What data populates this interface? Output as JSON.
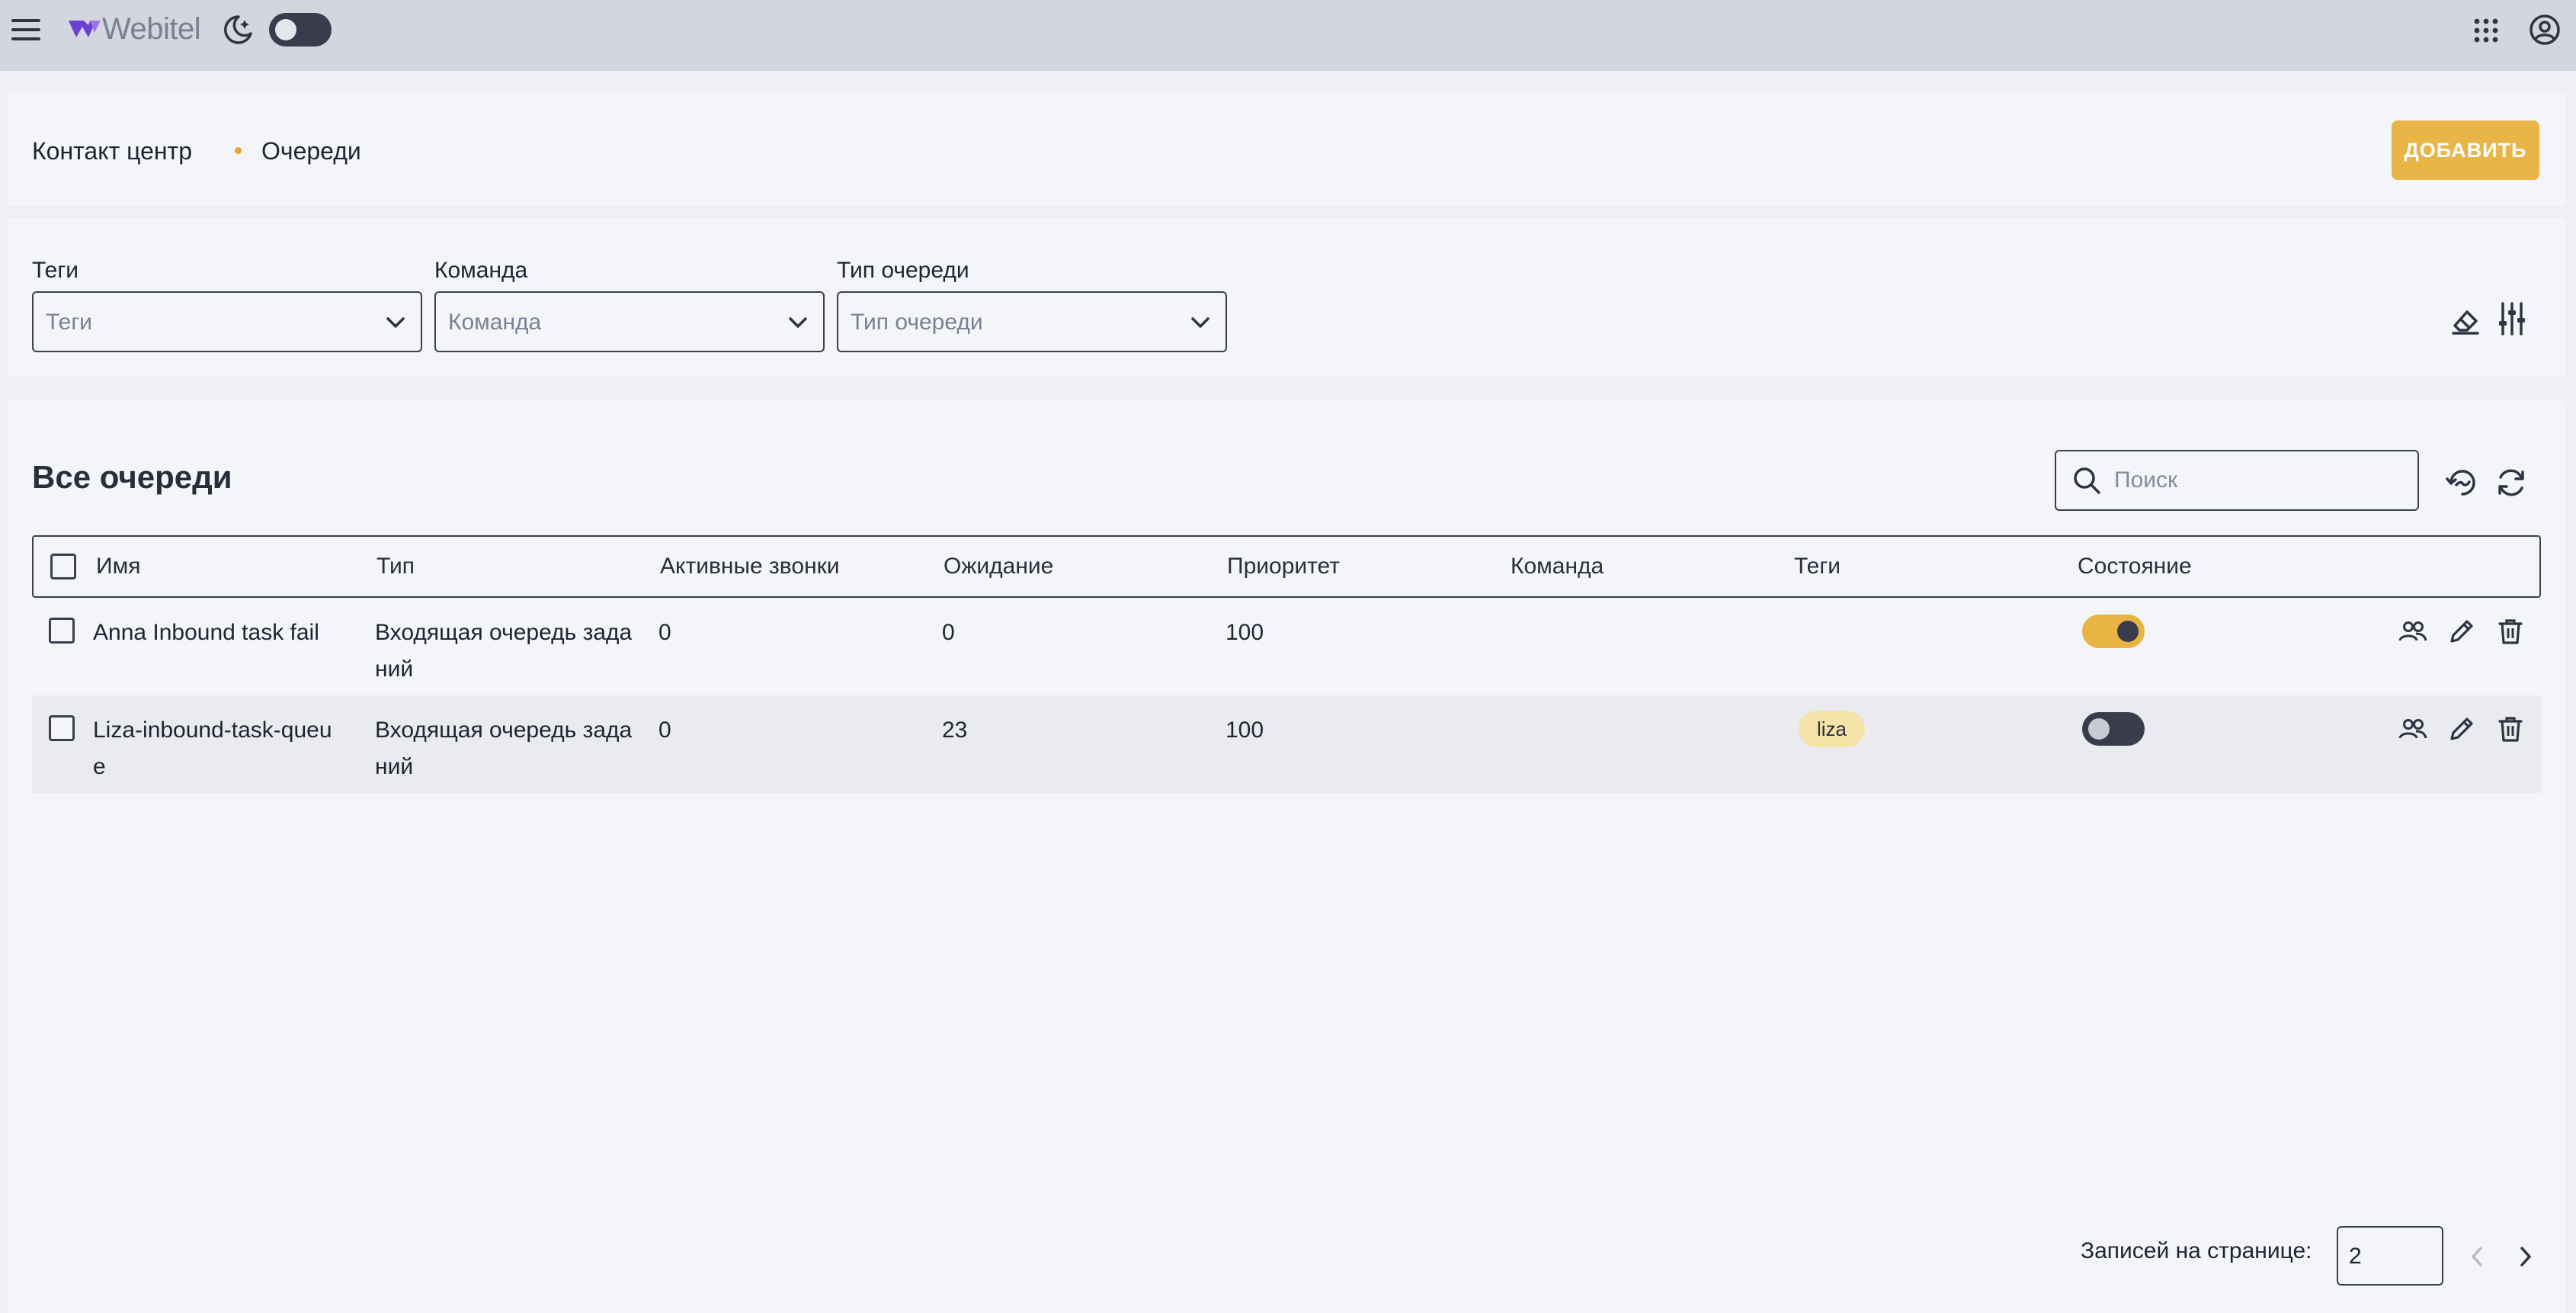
{
  "header": {
    "logo_text": "Webitel",
    "menu_icon": "hamburger-icon",
    "theme_icon": "moon-icon",
    "apps_icon": "apps-grid-icon",
    "account_icon": "user-circle-icon",
    "theme_dark": false
  },
  "breadcrumb": {
    "items": [
      "Контакт центр",
      "Очереди"
    ]
  },
  "actions": {
    "add_label": "ДОБАВИТЬ"
  },
  "filters": {
    "tags": {
      "label": "Теги",
      "placeholder": "Теги"
    },
    "team": {
      "label": "Команда",
      "placeholder": "Команда"
    },
    "queue_type": {
      "label": "Тип очереди",
      "placeholder": "Тип очереди"
    }
  },
  "table": {
    "title": "Все очереди",
    "search_placeholder": "Поиск",
    "columns": [
      "Имя",
      "Тип",
      "Активные звонки",
      "Ожидание",
      "Приоритет",
      "Команда",
      "Теги",
      "Состояние"
    ],
    "rows": [
      {
        "name_lines": [
          "Anna Inbound task fail",
          ""
        ],
        "type_lines": [
          "Входящая очередь зада",
          "ний"
        ],
        "active_calls": "0",
        "waiting": "0",
        "priority": "100",
        "team": "",
        "tag": "",
        "state_on": true
      },
      {
        "name_lines": [
          "Liza-inbound-task-queu",
          "e"
        ],
        "type_lines": [
          "Входящая очередь зада",
          "ний"
        ],
        "active_calls": "0",
        "waiting": "23",
        "priority": "100",
        "team": "",
        "tag": "liza",
        "state_on": false
      }
    ]
  },
  "pagination": {
    "label": "Записей на странице:",
    "per_page": "2"
  },
  "colors": {
    "accent": "#e9b546",
    "topbar": "#d3d5df",
    "tag_bg": "#f6e3a8",
    "dark": "#393c4d"
  }
}
